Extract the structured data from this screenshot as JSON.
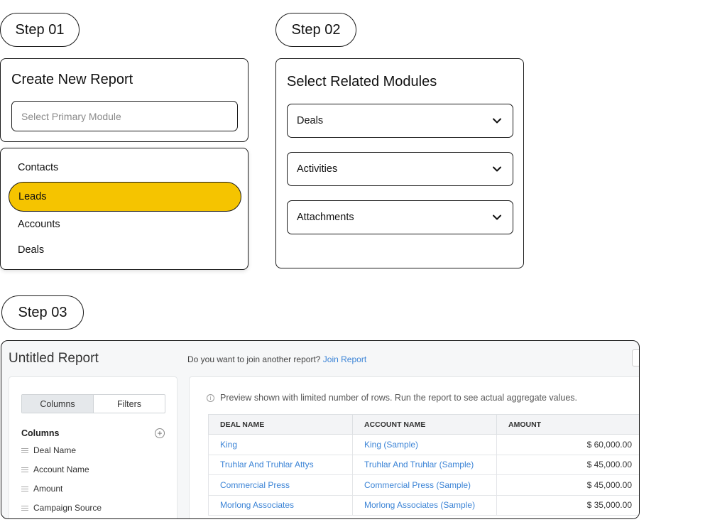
{
  "steps": {
    "step1_label": "Step 01",
    "step2_label": "Step 02",
    "step3_label": "Step 03"
  },
  "step1": {
    "title": "Create New Report",
    "input_placeholder": "Select Primary Module",
    "options": [
      "Contacts",
      "Leads",
      "Accounts",
      "Deals"
    ],
    "selected": "Leads",
    "highlight_color": "#f5c400"
  },
  "step2": {
    "title": "Select Related Modules",
    "dropdowns": [
      "Deals",
      "Activities",
      "Attachments"
    ]
  },
  "step3": {
    "report_title": "Untitled Report",
    "join_prompt": "Do you want to join another report?",
    "join_link": "Join Report",
    "tabs": [
      "Columns",
      "Filters"
    ],
    "active_tab": "Columns",
    "columns_heading": "Columns",
    "fields": [
      "Deal Name",
      "Account Name",
      "Amount",
      "Campaign Source"
    ],
    "preview_note": "Preview shown with limited number of rows. Run the report to see actual aggregate values.",
    "table": {
      "headers": [
        "DEAL NAME",
        "ACCOUNT NAME",
        "AMOUNT"
      ],
      "rows": [
        [
          "King",
          "King (Sample)",
          "$ 60,000.00"
        ],
        [
          "Truhlar And Truhlar Attys",
          "Truhlar And Truhlar (Sample)",
          "$ 45,000.00"
        ],
        [
          "Commercial Press",
          "Commercial Press (Sample)",
          "$ 45,000.00"
        ],
        [
          "Morlong Associates",
          "Morlong Associates (Sample)",
          "$ 35,000.00"
        ]
      ]
    },
    "link_color": "#3c84d6"
  }
}
